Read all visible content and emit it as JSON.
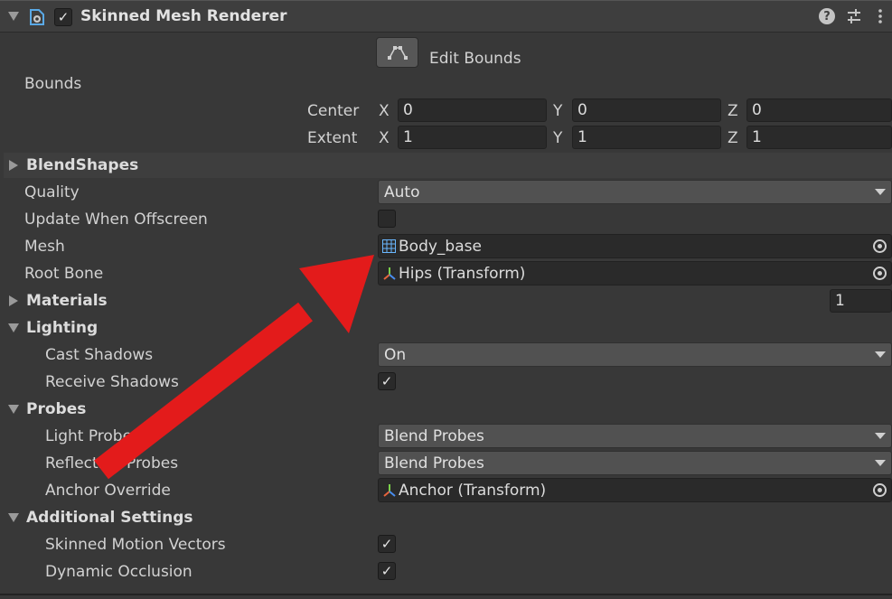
{
  "component": {
    "title": "Skinned Mesh Renderer",
    "enabled": true,
    "icons": [
      "help-icon",
      "presets-icon",
      "kebab-menu-icon"
    ]
  },
  "edit_bounds": {
    "label": "Edit Bounds"
  },
  "bounds": {
    "label": "Bounds",
    "center": {
      "label": "Center",
      "x_label": "X",
      "x": "0",
      "y_label": "Y",
      "y": "0",
      "z_label": "Z",
      "z": "0"
    },
    "extent": {
      "label": "Extent",
      "x_label": "X",
      "x": "1",
      "y_label": "Y",
      "y": "1",
      "z_label": "Z",
      "z": "1"
    }
  },
  "sections": {
    "blendshapes": "BlendShapes",
    "materials": "Materials",
    "lighting": "Lighting",
    "probes": "Probes",
    "additional": "Additional Settings"
  },
  "fields": {
    "quality": {
      "label": "Quality",
      "value": "Auto"
    },
    "update_offscreen": {
      "label": "Update When Offscreen",
      "checked": false
    },
    "mesh": {
      "label": "Mesh",
      "value": "Body_base"
    },
    "root_bone": {
      "label": "Root Bone",
      "value": "Hips (Transform)"
    },
    "materials_count": "1",
    "cast_shadows": {
      "label": "Cast Shadows",
      "value": "On"
    },
    "receive_shadows": {
      "label": "Receive Shadows",
      "checked": true
    },
    "light_probes": {
      "label": "Light Probes",
      "value": "Blend Probes"
    },
    "reflection_probes": {
      "label": "Reflection Probes",
      "value": "Blend Probes"
    },
    "anchor_override": {
      "label": "Anchor Override",
      "value": "Anchor (Transform)"
    },
    "skinned_motion_vectors": {
      "label": "Skinned Motion Vectors",
      "checked": true
    },
    "dynamic_occlusion": {
      "label": "Dynamic Occlusion",
      "checked": true
    }
  },
  "annotation": {
    "arrow_color": "#e31b1b",
    "points_to": "mesh-field"
  },
  "colors": {
    "background": "#383838",
    "field": "#2a2a2a",
    "dropdown": "#515151",
    "accent_arrow": "#e31b1b"
  }
}
